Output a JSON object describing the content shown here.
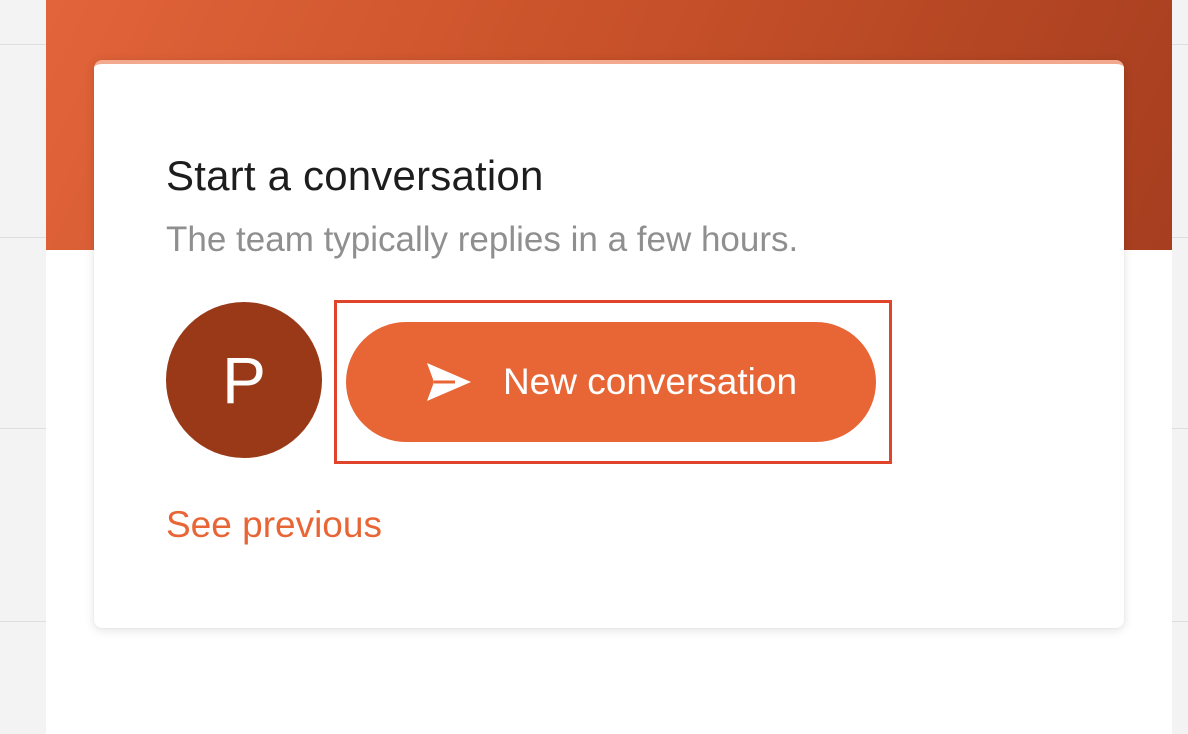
{
  "card": {
    "title": "Start a conversation",
    "subtitle": "The team typically replies in a few hours."
  },
  "avatar": {
    "initial": "P"
  },
  "actions": {
    "new_conversation_label": "New conversation",
    "new_conversation_icon": "send-icon",
    "see_previous_label": "See previous"
  },
  "colors": {
    "accent": "#e86535",
    "header_gradient_start": "#e2643a",
    "header_gradient_end": "#a63e1f",
    "avatar_bg": "#993917",
    "highlight": "#e0442a"
  }
}
